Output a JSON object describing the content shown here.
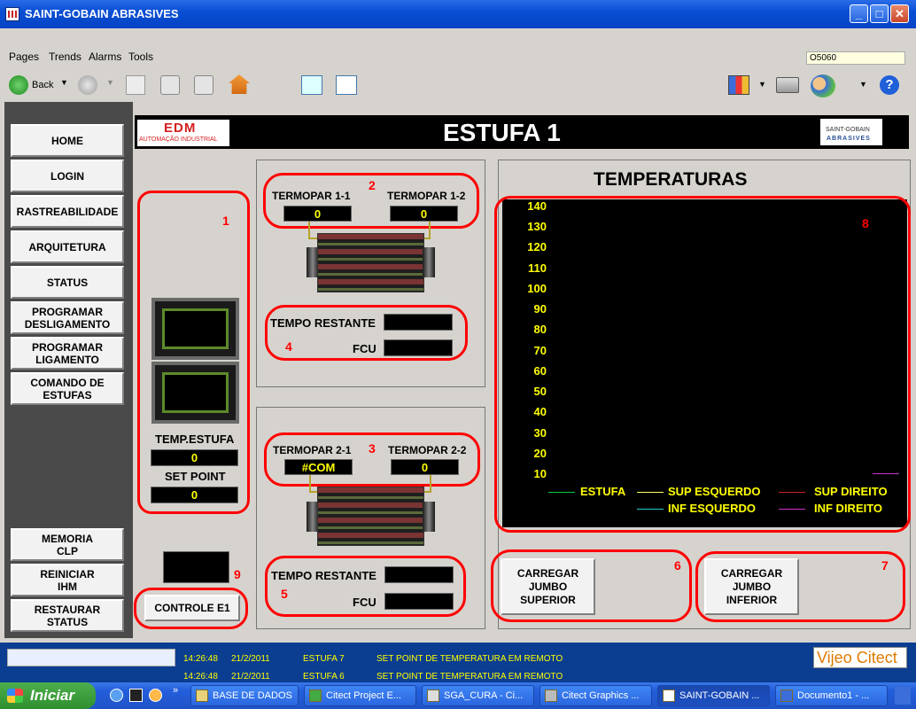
{
  "window": {
    "title": "SAINT-GOBAIN ABRASIVES"
  },
  "menu": {
    "items": [
      "Pages",
      "Trends",
      "Alarms",
      "Tools"
    ],
    "tag_value": "O5060"
  },
  "toolbar": {
    "back_label": "Back"
  },
  "nav": {
    "home": "HOME",
    "login": "LOGIN",
    "rastreabilidade": "RASTREABILIDADE",
    "arquitetura": "ARQUITETURA",
    "status": "STATUS",
    "programar_desligamento": "PROGRAMAR\nDESLIGAMENTO",
    "programar_ligamento": "PROGRAMAR\nLIGAMENTO",
    "comando_estufas": "COMANDO DE\nESTUFAS",
    "memoria_clp": "MEMORIA\nCLP",
    "reiniciar_ihm": "REINICIAR\nIHM",
    "restaurar_status": "RESTAURAR\nSTATUS"
  },
  "header": {
    "title": "ESTUFA 1",
    "edm_logo": "EDM",
    "edm_sub": "AUTOMAÇÃO INDUSTRIAL",
    "sg_logo_top": "SAINT-GOBAIN",
    "sg_logo_bottom": "ABRASIVES"
  },
  "oven": {
    "temp_label": "TEMP.ESTUFA",
    "temp_value": "0",
    "setpoint_label": "SET POINT",
    "setpoint_value": "0",
    "controle_label": "CONTROLE E1"
  },
  "zone1": {
    "t1_label": "TERMOPAR 1-1",
    "t1_value": "0",
    "t2_label": "TERMOPAR 1-2",
    "t2_value": "0",
    "tempo_label": "TEMPO RESTANTE",
    "fcu_label": "FCU"
  },
  "zone2": {
    "t1_label": "TERMOPAR 2-1",
    "t1_value": "#COM",
    "t2_label": "TERMOPAR 2-2",
    "t2_value": "0",
    "tempo_label": "TEMPO RESTANTE",
    "fcu_label": "FCU"
  },
  "annotations": [
    "1",
    "2",
    "3",
    "4",
    "5",
    "6",
    "7",
    "8",
    "9"
  ],
  "chart_data": {
    "type": "line",
    "title": "TEMPERATURAS",
    "ylim": [
      10,
      140
    ],
    "yticks": [
      "140",
      "130",
      "120",
      "110",
      "100",
      "90",
      "80",
      "70",
      "60",
      "50",
      "40",
      "30",
      "20",
      "10"
    ],
    "legend": [
      {
        "name": "ESTUFA",
        "color": "#00cc44"
      },
      {
        "name": "SUP ESQUERDO",
        "color": "#ffff66"
      },
      {
        "name": "SUP DIREITO",
        "color": "#cc2222"
      },
      {
        "name": "INF ESQUERDO",
        "color": "#22cccc"
      },
      {
        "name": "INF DIREITO",
        "color": "#cc33cc"
      }
    ],
    "series": []
  },
  "buttons": {
    "jumbo_superior": "CARREGAR\nJUMBO\nSUPERIOR",
    "jumbo_inferior": "CARREGAR\nJUMBO\nINFERIOR"
  },
  "alarms": [
    {
      "time": "14:26:48",
      "date": "21/2/2011",
      "tag": "ESTUFA 7",
      "msg": "SET POINT DE TEMPERATURA EM REMOTO"
    },
    {
      "time": "14:26:48",
      "date": "21/2/2011",
      "tag": "ESTUFA 6",
      "msg": "SET POINT DE TEMPERATURA EM REMOTO"
    }
  ],
  "vijeo_label": "Vijeo Citect",
  "taskbar": {
    "start_label": "Iniciar",
    "tasks": [
      "BASE DE DADOS",
      "Citect Project E...",
      "SGA_CURA - Ci...",
      "Citect Graphics ...",
      "SAINT-GOBAIN ...",
      "Documento1 - ..."
    ]
  }
}
